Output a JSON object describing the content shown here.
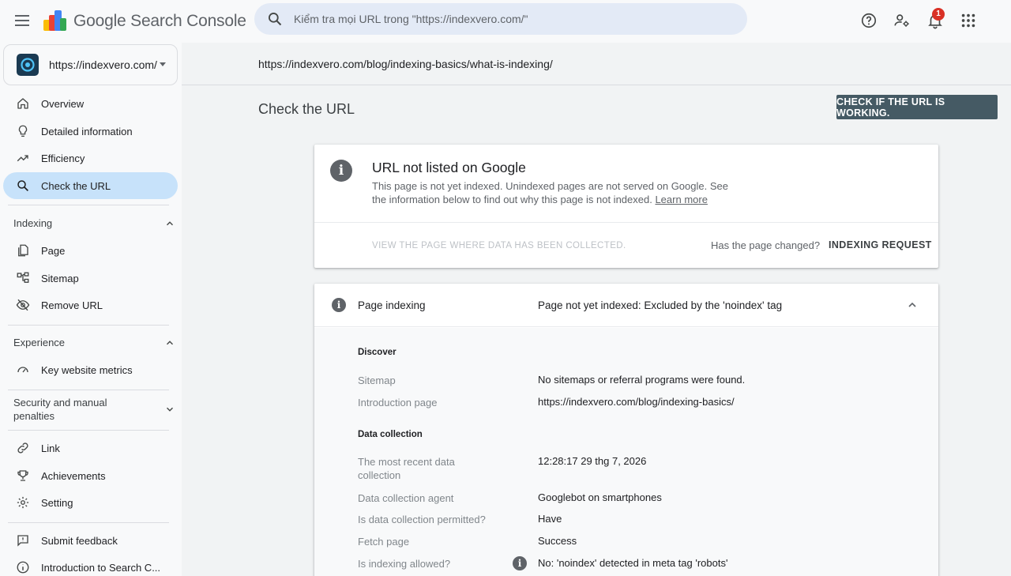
{
  "header": {
    "app_name": "Google Search Console",
    "search_placeholder": "Kiểm tra mọi URL trong \"https://indexvero.com/\"",
    "notification_count": "1"
  },
  "sidebar": {
    "property": "https://indexvero.com/",
    "items": [
      {
        "label": "Overview",
        "icon": "home-icon"
      },
      {
        "label": "Detailed information",
        "icon": "lightbulb-icon"
      },
      {
        "label": "Efficiency",
        "icon": "trending-up-icon"
      },
      {
        "label": "Check the URL",
        "icon": "search-icon",
        "active": true
      }
    ],
    "indexing": {
      "title": "Indexing",
      "items": [
        {
          "label": "Page",
          "icon": "pages-icon"
        },
        {
          "label": "Sitemap",
          "icon": "sitemap-icon"
        },
        {
          "label": "Remove URL",
          "icon": "eye-off-icon"
        }
      ]
    },
    "experience": {
      "title": "Experience",
      "items": [
        {
          "label": "Key website metrics",
          "icon": "speed-icon"
        }
      ]
    },
    "security": {
      "title": "Security and manual penalties"
    },
    "more": [
      {
        "label": "Link",
        "icon": "link-icon"
      },
      {
        "label": "Achievements",
        "icon": "trophy-icon"
      },
      {
        "label": "Setting",
        "icon": "gear-icon"
      }
    ],
    "footer": [
      {
        "label": "Submit feedback",
        "icon": "feedback-icon"
      },
      {
        "label": "Introduction to Search C...",
        "icon": "info-icon"
      }
    ]
  },
  "main": {
    "inspected_url": "https://indexvero.com/blog/indexing-basics/what-is-indexing/",
    "title": "Check the URL",
    "check_button": "CHECK IF THE URL IS WORKING.",
    "status_card": {
      "title": "URL not listed on Google",
      "description": "This page is not yet indexed. Unindexed pages are not served on Google. See the information below to find out why this page is not indexed.",
      "learn_more": "Learn more",
      "view_link": "VIEW THE PAGE WHERE DATA HAS BEEN COLLECTED.",
      "changed_question": "Has the page changed?",
      "request_button": "INDEXING REQUEST"
    },
    "indexing_card": {
      "label": "Page indexing",
      "value": "Page not yet indexed: Excluded by the 'noindex' tag",
      "discover_title": "Discover",
      "discover": [
        {
          "label": "Sitemap",
          "value": "No sitemaps or referral programs were found."
        },
        {
          "label": "Introduction page",
          "value": "https://indexvero.com/blog/indexing-basics/"
        }
      ],
      "collection_title": "Data collection",
      "collection": [
        {
          "label": "The most recent data collection",
          "value": "12:28:17 29 thg 7, 2026"
        },
        {
          "label": "Data collection agent",
          "value": "Googlebot on smartphones"
        },
        {
          "label": "Is data collection permitted?",
          "value": "Have"
        },
        {
          "label": "Fetch page",
          "value": "Success"
        },
        {
          "label": "Is indexing allowed?",
          "value": "No: 'noindex' detected in meta tag 'robots'"
        }
      ]
    }
  },
  "colors": {
    "active_nav": "#c7e2fa",
    "search_bg": "#e3eaf6",
    "check_button_bg": "#455a64",
    "badge": "#d93025"
  }
}
